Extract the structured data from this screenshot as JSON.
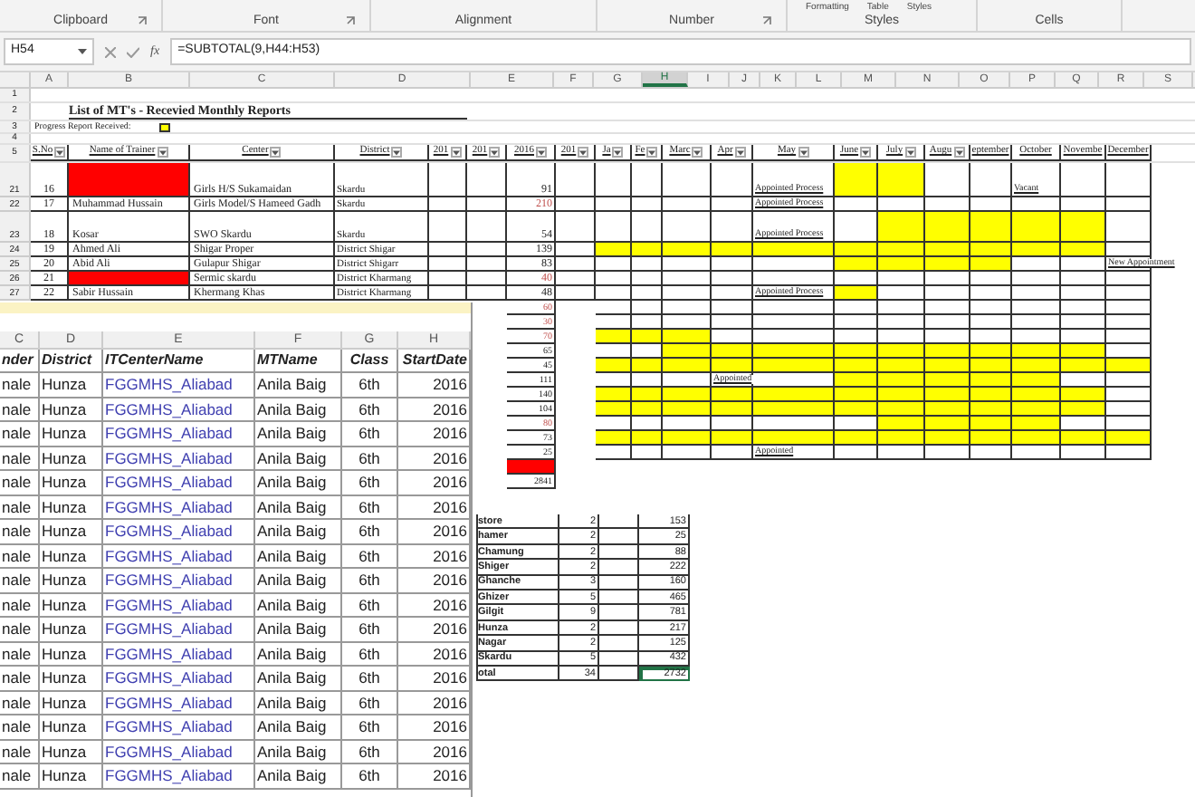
{
  "ribbon": {
    "groups": [
      {
        "label": "Clipboard",
        "launcher": true
      },
      {
        "label": "Font",
        "launcher": true
      },
      {
        "label": "Alignment",
        "launcher": false
      },
      {
        "label": "Number",
        "launcher": true
      },
      {
        "label": "Styles",
        "launcher": false,
        "buttons": [
          "Formatting",
          "Table",
          "Styles"
        ]
      },
      {
        "label": "Cells",
        "launcher": false
      }
    ]
  },
  "formula_bar": {
    "name_box": "H54",
    "function_label": "fx",
    "formula": "=SUBTOTAL(9,H44:H53)"
  },
  "sheet": {
    "column_letters": [
      {
        "label": "A",
        "selected": false
      },
      {
        "label": "B",
        "selected": false
      },
      {
        "label": "C",
        "selected": false
      },
      {
        "label": "D",
        "selected": false
      },
      {
        "label": "E",
        "selected": false
      },
      {
        "label": "F",
        "selected": false
      },
      {
        "label": "G",
        "selected": false
      },
      {
        "label": "H",
        "selected": true
      },
      {
        "label": "I",
        "selected": false
      },
      {
        "label": "J",
        "selected": false
      },
      {
        "label": "K",
        "selected": false
      },
      {
        "label": "L",
        "selected": false
      },
      {
        "label": "M",
        "selected": false
      },
      {
        "label": "N",
        "selected": false
      },
      {
        "label": "O",
        "selected": false
      },
      {
        "label": "P",
        "selected": false
      },
      {
        "label": "Q",
        "selected": false
      },
      {
        "label": "R",
        "selected": false
      },
      {
        "label": "S",
        "selected": false
      }
    ],
    "top_rows": [
      "1",
      "2",
      "3",
      "4",
      "5"
    ],
    "title": "List of MT's - Recevied Monthly Reports",
    "legend": "Progress Report Received:",
    "headers": [
      {
        "label": "S.No",
        "filter": true
      },
      {
        "label": "Name of Trainer",
        "filter": true
      },
      {
        "label": "Center",
        "filter": true
      },
      {
        "label": "District",
        "filter": true
      },
      {
        "label": "201",
        "filter": true
      },
      {
        "label": "201",
        "filter": true
      },
      {
        "label": "2016",
        "filter": true
      },
      {
        "label": "201",
        "filter": true
      },
      {
        "label": "Ja",
        "filter": true
      },
      {
        "label": "Fe",
        "filter": true
      },
      {
        "label": "Marc",
        "filter": true
      },
      {
        "label": "Apr",
        "filter": true
      },
      {
        "label": "May",
        "filter": true
      },
      {
        "label": "June",
        "filter": true
      },
      {
        "label": "July",
        "filter": true
      },
      {
        "label": "Augu",
        "filter": true
      },
      {
        "label": "eptember",
        "filter": false
      },
      {
        "label": "October",
        "filter": false
      },
      {
        "label": "Novembe",
        "filter": false
      },
      {
        "label": "December",
        "filter": false
      }
    ],
    "rows": [
      {
        "row": "21",
        "s_no": "16",
        "name_alert": true,
        "center": "Girls H/S Sukamaidan",
        "district": "Skardu",
        "value": "91",
        "value_alert": false,
        "months": [
          {
            "filled": false
          },
          {
            "filled": false
          },
          {
            "filled": false
          },
          {
            "filled": false
          },
          {
            "filled": false,
            "text": "Appointed Process"
          },
          {
            "filled": true
          },
          {
            "filled": true
          },
          {
            "filled": false
          },
          {
            "filled": false
          },
          {
            "filled": false,
            "text": "Vacant"
          },
          {
            "filled": false
          },
          {
            "filled": false
          }
        ]
      },
      {
        "row": "22",
        "s_no": "17",
        "name": "Muhammad Hussain",
        "name_alert": false,
        "center": "Girls Model/S Hameed Gadh",
        "district": "Skardu",
        "value": "210",
        "value_alert": true,
        "months": [
          {
            "filled": false
          },
          {
            "filled": false
          },
          {
            "filled": false
          },
          {
            "filled": false
          },
          {
            "filled": false,
            "text": "Appointed Process"
          },
          {
            "filled": false
          },
          {
            "filled": false
          },
          {
            "filled": false
          },
          {
            "filled": false
          },
          {
            "filled": false
          },
          {
            "filled": false
          },
          {
            "filled": false
          }
        ]
      },
      {
        "row": "23",
        "s_no": "18",
        "name": "Kosar",
        "name_alert": false,
        "center": "SWO Skardu",
        "district": "Skardu",
        "value": "54",
        "value_alert": false,
        "months": [
          {
            "filled": false
          },
          {
            "filled": false
          },
          {
            "filled": false
          },
          {
            "filled": false
          },
          {
            "filled": false,
            "text": "Appointed Process"
          },
          {
            "filled": false
          },
          {
            "filled": true
          },
          {
            "filled": true
          },
          {
            "filled": true
          },
          {
            "filled": true
          },
          {
            "filled": true
          },
          {
            "filled": false
          }
        ]
      },
      {
        "row": "24",
        "s_no": "19",
        "name": "Ahmed Ali",
        "name_alert": false,
        "center": "Shigar Proper",
        "district": "District Shigar",
        "value": "139",
        "value_alert": false,
        "months": [
          {
            "filled": true
          },
          {
            "filled": true
          },
          {
            "filled": true
          },
          {
            "filled": true
          },
          {
            "filled": true
          },
          {
            "filled": true
          },
          {
            "filled": true
          },
          {
            "filled": true
          },
          {
            "filled": true
          },
          {
            "filled": true
          },
          {
            "filled": true
          },
          {
            "filled": false
          }
        ]
      },
      {
        "row": "25",
        "s_no": "20",
        "name": "Abid Ali",
        "name_alert": false,
        "center": "Gulapur Shigar",
        "district": "District Shigarr",
        "value": "83",
        "value_alert": false,
        "months": [
          {
            "filled": false
          },
          {
            "filled": false
          },
          {
            "filled": false
          },
          {
            "filled": false
          },
          {
            "filled": false
          },
          {
            "filled": true
          },
          {
            "filled": true
          },
          {
            "filled": true
          },
          {
            "filled": true
          },
          {
            "filled": false
          },
          {
            "filled": false
          },
          {
            "filled": false,
            "text": "New Appointment"
          }
        ]
      },
      {
        "row": "26",
        "s_no": "21",
        "name_alert": true,
        "center": "Sermic skardu",
        "district": "District Kharmang",
        "value": "40",
        "value_alert": true,
        "months": [
          {
            "filled": false
          },
          {
            "filled": false
          },
          {
            "filled": false
          },
          {
            "filled": false
          },
          {
            "filled": false
          },
          {
            "filled": false
          },
          {
            "filled": false
          },
          {
            "filled": false
          },
          {
            "filled": false
          },
          {
            "filled": false
          },
          {
            "filled": false
          },
          {
            "filled": false
          }
        ]
      },
      {
        "row": "27",
        "s_no": "22",
        "name": "Sabir Hussain",
        "name_alert": false,
        "center": "Khermang Khas",
        "district": "District Kharmang",
        "value": "48",
        "value_alert": false,
        "months": [
          {
            "filled": false
          },
          {
            "filled": false
          },
          {
            "filled": false
          },
          {
            "filled": false
          },
          {
            "filled": false,
            "text": "Appointed Process"
          },
          {
            "filled": true
          },
          {
            "filled": false
          },
          {
            "filled": false
          },
          {
            "filled": false
          },
          {
            "filled": false
          },
          {
            "filled": false
          },
          {
            "filled": false
          }
        ]
      }
    ],
    "more_rows": [
      {
        "value": "60",
        "value_alert": true,
        "alert_fill": false,
        "months": [
          {
            "filled": false
          },
          {
            "filled": false
          },
          {
            "filled": false
          },
          {
            "filled": false
          },
          {
            "filled": false
          },
          {
            "filled": false
          },
          {
            "filled": false
          },
          {
            "filled": false
          },
          {
            "filled": false
          },
          {
            "filled": false
          },
          {
            "filled": false
          },
          {
            "filled": false
          }
        ]
      },
      {
        "value": "30",
        "value_alert": true,
        "alert_fill": false,
        "months": [
          {
            "filled": false
          },
          {
            "filled": false
          },
          {
            "filled": false
          },
          {
            "filled": false
          },
          {
            "filled": false
          },
          {
            "filled": false
          },
          {
            "filled": false
          },
          {
            "filled": false
          },
          {
            "filled": false
          },
          {
            "filled": false
          },
          {
            "filled": false
          },
          {
            "filled": false
          }
        ]
      },
      {
        "value": "70",
        "value_alert": true,
        "alert_fill": false,
        "months": [
          {
            "filled": true
          },
          {
            "filled": true
          },
          {
            "filled": true
          },
          {
            "filled": false
          },
          {
            "filled": false
          },
          {
            "filled": false
          },
          {
            "filled": false
          },
          {
            "filled": false
          },
          {
            "filled": false
          },
          {
            "filled": false
          },
          {
            "filled": false
          },
          {
            "filled": false
          }
        ]
      },
      {
        "value": "65",
        "value_alert": false,
        "alert_fill": false,
        "months": [
          {
            "filled": false
          },
          {
            "filled": false
          },
          {
            "filled": true
          },
          {
            "filled": true
          },
          {
            "filled": true
          },
          {
            "filled": true
          },
          {
            "filled": true
          },
          {
            "filled": true
          },
          {
            "filled": true
          },
          {
            "filled": true
          },
          {
            "filled": true
          },
          {
            "filled": false
          }
        ]
      },
      {
        "value": "45",
        "value_alert": false,
        "alert_fill": false,
        "months": [
          {
            "filled": true
          },
          {
            "filled": true
          },
          {
            "filled": true
          },
          {
            "filled": true
          },
          {
            "filled": true
          },
          {
            "filled": true
          },
          {
            "filled": true
          },
          {
            "filled": true
          },
          {
            "filled": true
          },
          {
            "filled": true
          },
          {
            "filled": true
          },
          {
            "filled": true
          }
        ]
      },
      {
        "value": "111",
        "value_alert": false,
        "alert_fill": false,
        "months": [
          {
            "filled": false
          },
          {
            "filled": false
          },
          {
            "filled": false
          },
          {
            "filled": false,
            "text": "Appointed"
          },
          {
            "filled": false
          },
          {
            "filled": true
          },
          {
            "filled": true
          },
          {
            "filled": true
          },
          {
            "filled": true
          },
          {
            "filled": true
          },
          {
            "filled": false
          },
          {
            "filled": false
          }
        ]
      },
      {
        "value": "140",
        "value_alert": false,
        "alert_fill": false,
        "months": [
          {
            "filled": true
          },
          {
            "filled": true
          },
          {
            "filled": true
          },
          {
            "filled": true
          },
          {
            "filled": true
          },
          {
            "filled": true
          },
          {
            "filled": true
          },
          {
            "filled": true
          },
          {
            "filled": true
          },
          {
            "filled": true
          },
          {
            "filled": true
          },
          {
            "filled": false
          }
        ]
      },
      {
        "value": "104",
        "value_alert": false,
        "alert_fill": false,
        "months": [
          {
            "filled": true
          },
          {
            "filled": true
          },
          {
            "filled": true
          },
          {
            "filled": true
          },
          {
            "filled": true
          },
          {
            "filled": true
          },
          {
            "filled": true
          },
          {
            "filled": true
          },
          {
            "filled": true
          },
          {
            "filled": true
          },
          {
            "filled": true
          },
          {
            "filled": false
          }
        ]
      },
      {
        "value": "80",
        "value_alert": true,
        "alert_fill": false,
        "months": [
          {
            "filled": false
          },
          {
            "filled": false
          },
          {
            "filled": false
          },
          {
            "filled": false
          },
          {
            "filled": false
          },
          {
            "filled": false
          },
          {
            "filled": true
          },
          {
            "filled": true
          },
          {
            "filled": true
          },
          {
            "filled": true
          },
          {
            "filled": false
          },
          {
            "filled": false
          }
        ]
      },
      {
        "value": "73",
        "value_alert": false,
        "alert_fill": false,
        "months": [
          {
            "filled": true
          },
          {
            "filled": true
          },
          {
            "filled": true
          },
          {
            "filled": true
          },
          {
            "filled": true
          },
          {
            "filled": true
          },
          {
            "filled": true
          },
          {
            "filled": true
          },
          {
            "filled": true
          },
          {
            "filled": true
          },
          {
            "filled": true
          },
          {
            "filled": true
          }
        ]
      },
      {
        "value": "25",
        "value_alert": false,
        "alert_fill": false,
        "months": [
          {
            "filled": false
          },
          {
            "filled": false
          },
          {
            "filled": false
          },
          {
            "filled": false
          },
          {
            "filled": false,
            "text": "Appointed"
          },
          {
            "filled": false
          },
          {
            "filled": false
          },
          {
            "filled": false
          },
          {
            "filled": false
          },
          {
            "filled": false
          },
          {
            "filled": false
          },
          {
            "filled": false
          }
        ]
      },
      {
        "value_alert": false,
        "alert_fill": true
      },
      {
        "value": "2841",
        "value_alert": false,
        "alert_fill": false
      }
    ],
    "summary": [
      {
        "name": "store",
        "count": "2",
        "total": "153",
        "selected": false
      },
      {
        "name": "hamer",
        "count": "2",
        "total": "25",
        "selected": false
      },
      {
        "name": "Chamung",
        "count": "2",
        "total": "88",
        "selected": false
      },
      {
        "name": "Shiger",
        "count": "2",
        "total": "222",
        "selected": false
      },
      {
        "name": "Ghanche",
        "count": "3",
        "total": "160",
        "selected": false
      },
      {
        "name": "Ghizer",
        "count": "5",
        "total": "465",
        "selected": false
      },
      {
        "name": "Gilgit",
        "count": "9",
        "total": "781",
        "selected": false
      },
      {
        "name": "Hunza",
        "count": "2",
        "total": "217",
        "selected": false
      },
      {
        "name": "Nagar",
        "count": "2",
        "total": "125",
        "selected": false
      },
      {
        "name": "Skardu",
        "count": "5",
        "total": "432",
        "selected": false
      },
      {
        "name": "otal",
        "count": "34",
        "total": "2732",
        "selected": true
      }
    ]
  },
  "overlay_table": {
    "column_letters": [
      "C",
      "D",
      "E",
      "F",
      "G",
      "H"
    ],
    "headers": [
      {
        "label": "nder",
        "kind": "text"
      },
      {
        "label": "District",
        "kind": "text"
      },
      {
        "label": "ITCenterName",
        "kind": "link"
      },
      {
        "label": "MTName",
        "kind": "text"
      },
      {
        "label": "Class",
        "kind": "center"
      },
      {
        "label": "StartDate",
        "kind": "number"
      }
    ],
    "rows": [
      [
        "nale",
        "Hunza",
        "FGGMHS_Aliabad",
        "Anila Baig",
        "6th",
        "2016"
      ],
      [
        "nale",
        "Hunza",
        "FGGMHS_Aliabad",
        "Anila Baig",
        "6th",
        "2016"
      ],
      [
        "nale",
        "Hunza",
        "FGGMHS_Aliabad",
        "Anila Baig",
        "6th",
        "2016"
      ],
      [
        "nale",
        "Hunza",
        "FGGMHS_Aliabad",
        "Anila Baig",
        "6th",
        "2016"
      ],
      [
        "nale",
        "Hunza",
        "FGGMHS_Aliabad",
        "Anila Baig",
        "6th",
        "2016"
      ],
      [
        "nale",
        "Hunza",
        "FGGMHS_Aliabad",
        "Anila Baig",
        "6th",
        "2016"
      ],
      [
        "nale",
        "Hunza",
        "FGGMHS_Aliabad",
        "Anila Baig",
        "6th",
        "2016"
      ],
      [
        "nale",
        "Hunza",
        "FGGMHS_Aliabad",
        "Anila Baig",
        "6th",
        "2016"
      ],
      [
        "nale",
        "Hunza",
        "FGGMHS_Aliabad",
        "Anila Baig",
        "6th",
        "2016"
      ],
      [
        "nale",
        "Hunza",
        "FGGMHS_Aliabad",
        "Anila Baig",
        "6th",
        "2016"
      ],
      [
        "nale",
        "Hunza",
        "FGGMHS_Aliabad",
        "Anila Baig",
        "6th",
        "2016"
      ],
      [
        "nale",
        "Hunza",
        "FGGMHS_Aliabad",
        "Anila Baig",
        "6th",
        "2016"
      ],
      [
        "nale",
        "Hunza",
        "FGGMHS_Aliabad",
        "Anila Baig",
        "6th",
        "2016"
      ],
      [
        "nale",
        "Hunza",
        "FGGMHS_Aliabad",
        "Anila Baig",
        "6th",
        "2016"
      ],
      [
        "nale",
        "Hunza",
        "FGGMHS_Aliabad",
        "Anila Baig",
        "6th",
        "2016"
      ],
      [
        "nale",
        "Hunza",
        "FGGMHS_Aliabad",
        "Anila Baig",
        "6th",
        "2016"
      ],
      [
        "nale",
        "Hunza",
        "FGGMHS_Aliabad",
        "Anila Baig",
        "6th",
        "2016"
      ]
    ]
  }
}
